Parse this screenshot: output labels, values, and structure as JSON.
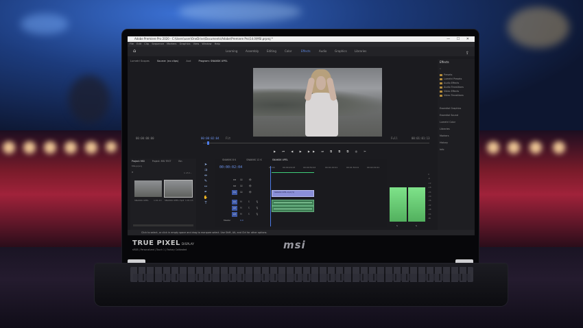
{
  "window": {
    "title": "Adobe Premiere Pro 2020 - C:\\Users\\user\\OneDrive\\Documents\\Adobe\\Premiere Pro\\14.0\\MSI.prproj *",
    "controls": "—  ☐  ✕"
  },
  "menu": [
    "File",
    "Edit",
    "Clip",
    "Sequence",
    "Markers",
    "Graphics",
    "View",
    "Window",
    "Help"
  ],
  "workspaces": {
    "items": [
      "Learning",
      "Assembly",
      "Editing",
      "Color",
      "Effects",
      "Audio",
      "Graphics",
      "Libraries"
    ],
    "active": "Effects"
  },
  "source_tabs": [
    "Lumetri Scopes",
    "Source: (no clips)",
    "Aud",
    "Program: SNAKKK UPEL"
  ],
  "program": {
    "timecode_left": "00:00:02:04",
    "fit": "Fit",
    "zoom": "Full",
    "timecode_right": "00:01:01:13",
    "source_tc": "00:00:00:00"
  },
  "transport": "▶  ⏮  ◀  ▶  ▶▶  ⏭  ⧉  ⧉  ⧉  ◎  ✂",
  "effects_panel": {
    "title": "Effects",
    "folders": [
      "Presets",
      "Lumetri Presets",
      "Audio Effects",
      "Audio Transitions",
      "Video Effects",
      "Video Transitions"
    ],
    "panels": [
      "Essential Graphics",
      "Essential Sound",
      "Lumetri Color",
      "Libraries",
      "Markers",
      "History",
      "Info"
    ]
  },
  "project": {
    "tabs": [
      "Project: MSI",
      "Project: MSI TEST",
      "Bin"
    ],
    "path": "MSI.prproj",
    "count": "1 of 2...",
    "items": [
      {
        "name": "SNAKKK UPEL",
        "duration": "1:01:13"
      },
      {
        "name": "SNAKKK UPEL.mp4",
        "duration": "1:01:13"
      }
    ]
  },
  "timeline": {
    "tabs": [
      "SNAKKK 8 K",
      "SNAKKK 12 K",
      "SNAKKK UPEL"
    ],
    "active_tab": "SNAKKK UPEL",
    "timecode": "00:00:02:04",
    "ruler": [
      "00:00",
      "00:00:29:23",
      "00:00:59:22",
      "00:01:29:21",
      "00:01:59:21",
      "00:02:29:21"
    ],
    "tracks_video": [
      "V3",
      "V2",
      "V1"
    ],
    "tracks_audio": [
      "A1",
      "A2",
      "A3"
    ],
    "master": "Master",
    "master_value": "0.0",
    "clip_name": "SNAKKK UPEL.mp4 [V]"
  },
  "meters": {
    "scale": [
      "0",
      "-6",
      "-12",
      "-18",
      "-24",
      "-30",
      "-36",
      "-42",
      "-48",
      "-54",
      "dB"
    ],
    "labels": [
      "S",
      "S"
    ]
  },
  "status": "Click to select, or click in empty space and drag to marquee select. Use Shift, Alt, and Ctrl for other options.",
  "bezel": {
    "badge_main": "TRUE PIXEL",
    "badge_side": "DISPLAY",
    "badge_sub": "sRGB | Personalized | Touch 1 | Factory Calibrated",
    "brand": "msi"
  }
}
